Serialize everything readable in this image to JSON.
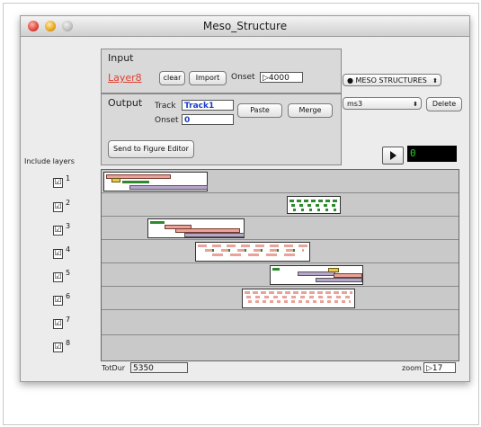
{
  "window": {
    "title": "Meso_Structure"
  },
  "input_panel": {
    "heading": "Input",
    "layer_name": "Layer8",
    "clear_label": "clear",
    "import_label": "Import",
    "onset_label": "Onset",
    "onset_value": "4000"
  },
  "output_panel": {
    "heading": "Output",
    "track_label": "Track",
    "track_value": "Track1",
    "onset_label": "Onset",
    "onset_value": "0",
    "paste_label": "Paste",
    "merge_label": "Merge",
    "send_label": "Send to Figure Editor"
  },
  "meso_select": "MESO STRUCTURES",
  "ms_select": "ms3",
  "delete_label": "Delete",
  "counter_value": "0",
  "include_layers_label": "Include layers",
  "layers": [
    {
      "number": "1",
      "checked": "☑"
    },
    {
      "number": "2",
      "checked": "☑"
    },
    {
      "number": "3",
      "checked": "☑"
    },
    {
      "number": "4",
      "checked": "☑"
    },
    {
      "number": "5",
      "checked": "☑"
    },
    {
      "number": "6",
      "checked": "☑"
    },
    {
      "number": "7",
      "checked": "☑"
    },
    {
      "number": "8",
      "checked": "☑"
    }
  ],
  "footer": {
    "totdur_label": "TotDur",
    "totdur_value": "5350",
    "zoom_label": "zoom",
    "zoom_value": "17"
  },
  "colors": {
    "layer_name": "#e04030",
    "counter_text": "#25d325",
    "note_pink": "#e8a39a",
    "note_green": "#2f8a2f",
    "note_purple": "#b7a6cc"
  }
}
